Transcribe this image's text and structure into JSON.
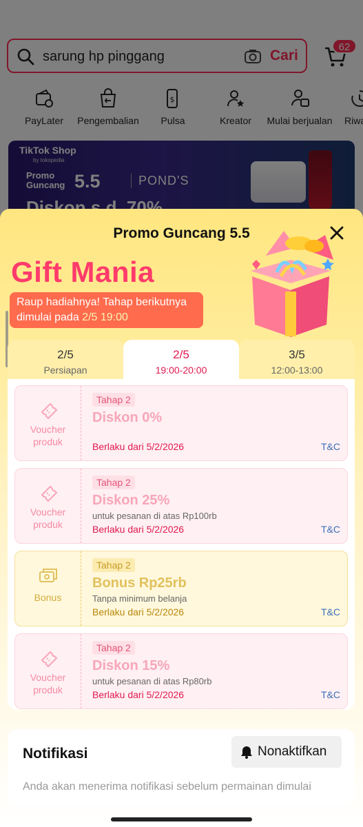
{
  "search": {
    "query": "sarung hp pinggang",
    "button_label": "Cari",
    "cart_count": "62"
  },
  "shortcuts": [
    {
      "label": "PayLater",
      "icon": "paylater-wallet-icon"
    },
    {
      "label": "Pengembalian",
      "icon": "return-bag-icon"
    },
    {
      "label": "Pulsa",
      "icon": "phone-pulsa-icon"
    },
    {
      "label": "Kreator",
      "icon": "creator-star-icon"
    },
    {
      "label": "Mulai berjualan",
      "icon": "seller-start-icon"
    },
    {
      "label": "Riwa",
      "icon": "history-icon"
    }
  ],
  "banner": {
    "shop": "TikTok Shop",
    "sub": "by tokopedia",
    "promo": "Promo\nGuncang",
    "promo_big": "5.5",
    "brand": "POND'S",
    "discount": "Diskon s.d. 70%"
  },
  "sheet": {
    "title": "Promo Guncang 5.5",
    "headline": "Gift Mania",
    "info_text": "Raup hadiahnya! Tahap berikutnya dimulai pada ",
    "info_highlight": "2/5 19:00",
    "tabs": [
      {
        "day": "2/5",
        "sub": "Persiapan",
        "active": false
      },
      {
        "day": "2/5",
        "sub": "19:00-20:00",
        "active": true
      },
      {
        "day": "3/5",
        "sub": "12:00-13:00",
        "active": false
      }
    ],
    "rewards": [
      {
        "type": "Voucher produk",
        "stage": "Tahap 2",
        "title": "Diskon 0%",
        "min": "",
        "valid": "Berlaku dari 5/2/2026",
        "tc": "T&C",
        "kind": "voucher"
      },
      {
        "type": "Voucher produk",
        "stage": "Tahap 2",
        "title": "Diskon 25%",
        "min": "untuk pesanan di atas Rp100rb",
        "valid": "Berlaku dari 5/2/2026",
        "tc": "T&C",
        "kind": "voucher"
      },
      {
        "type": "Bonus",
        "stage": "Tahap 2",
        "title": "Bonus Rp25rb",
        "min": "Tanpa minimum belanja",
        "valid": "Berlaku dari 5/2/2026",
        "tc": "T&C",
        "kind": "bonus"
      },
      {
        "type": "Voucher produk",
        "stage": "Tahap 2",
        "title": "Diskon 15%",
        "min": "untuk pesanan di atas Rp80rb",
        "valid": "Berlaku dari 5/2/2026",
        "tc": "T&C",
        "kind": "voucher"
      }
    ],
    "notification": {
      "title": "Notifikasi",
      "button_label": "Nonaktifkan",
      "description": "Anda akan menerima notifikasi sebelum permainan dimulai"
    }
  },
  "colors": {
    "accent": "#fe2c55",
    "headline": "#ff3b6b",
    "info_pill": "#ff6b4d",
    "link": "#3b6fb6"
  }
}
